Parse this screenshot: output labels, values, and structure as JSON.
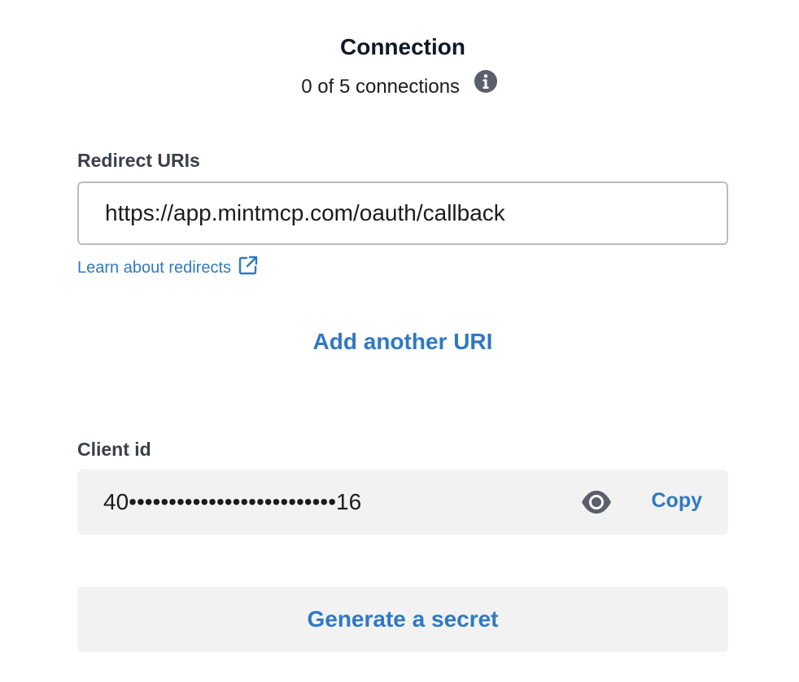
{
  "connection": {
    "title": "Connection",
    "count_text": "0 of 5 connections",
    "info_icon": "info-circle-icon"
  },
  "redirect": {
    "label": "Redirect URIs",
    "uri_value": "https://app.mintmcp.com/oauth/callback",
    "learn_link": "Learn about redirects",
    "learn_link_icon": "external-link-icon",
    "add_uri_label": "Add another URI"
  },
  "client": {
    "label": "Client id",
    "masked_value": "40••••••••••••••••••••••••••16",
    "reveal_icon": "eye-icon",
    "copy_label": "Copy"
  },
  "secret": {
    "generate_label": "Generate a secret"
  },
  "colors": {
    "accent": "#2f79c2",
    "label": "#3a3f4a",
    "field_background": "#f2f2f3",
    "input_border": "#b9bcc2"
  }
}
